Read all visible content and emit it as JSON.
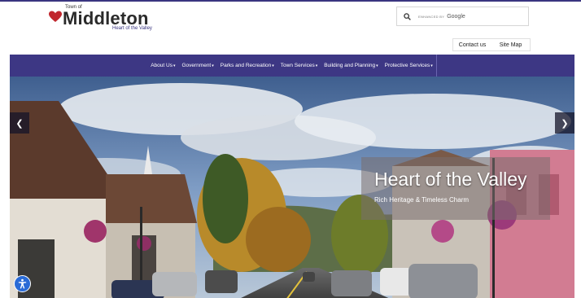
{
  "header": {
    "logo": {
      "prefix": "Town of",
      "name": "Middleton",
      "tagline": "Heart of the Valley"
    },
    "search": {
      "enhanced_label": "ENHANCED BY",
      "provider": "Google",
      "icon": "search-icon"
    },
    "utility_links": [
      "Contact us",
      "Site Map"
    ]
  },
  "nav": {
    "items": [
      "About Us",
      "Government",
      "Parks and Recreation",
      "Town Services",
      "Building and Planning",
      "Protective Services"
    ]
  },
  "hero": {
    "title": "Heart of the Valley",
    "subtitle": "Rich Heritage & Timeless Charm",
    "prev_icon": "chevron-left-icon",
    "next_icon": "chevron-right-icon"
  },
  "accessibility": {
    "icon": "accessibility-icon"
  },
  "colors": {
    "brand": "#3d3784",
    "heart": "#c0262d"
  }
}
